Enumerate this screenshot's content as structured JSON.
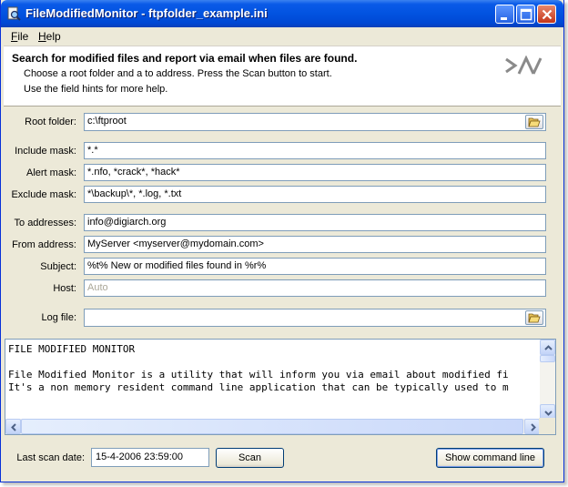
{
  "window": {
    "title": "FileModifiedMonitor - ftpfolder_example.ini",
    "icons": {
      "app": "magnifier-file-icon",
      "minimize": "minimize-icon",
      "maximize": "maximize-icon",
      "close": "close-icon"
    }
  },
  "menu": {
    "file": "File",
    "help": "Help"
  },
  "header": {
    "title": "Search for modified files and report via email when files are found.",
    "line1": "Choose a root folder and a to address. Press the Scan button to start.",
    "line2": "Use the field hints for more help.",
    "logo_icon": "digiarch-logo-icon"
  },
  "form": {
    "root_folder": {
      "label": "Root folder:",
      "value": "c:\\ftproot",
      "icon": "folder-open-icon"
    },
    "include_mask": {
      "label": "Include mask:",
      "value": "*.*"
    },
    "alert_mask": {
      "label": "Alert mask:",
      "value": "*.nfo, *crack*, *hack*"
    },
    "exclude_mask": {
      "label": "Exclude mask:",
      "value": "*\\backup\\*, *.log, *.txt"
    },
    "to_addresses": {
      "label": "To addresses:",
      "value": "info@digiarch.org"
    },
    "from_address": {
      "label": "From address:",
      "value": "MyServer <myserver@mydomain.com>"
    },
    "subject": {
      "label": "Subject:",
      "value": "%t% New or modified files found in %r%"
    },
    "host": {
      "label": "Host:",
      "value": "Auto"
    },
    "log_file": {
      "label": "Log file:",
      "value": "",
      "icon": "folder-open-icon"
    }
  },
  "memo": {
    "lines": [
      "FILE MODIFIED MONITOR",
      "",
      "File Modified Monitor is a utility that will inform you via email about modified fi",
      "It's a non memory resident command line application that can be typically used to m"
    ]
  },
  "footer": {
    "last_scan_label": "Last scan date:",
    "last_scan_value": "15-4-2006 23:59:00",
    "scan_button": "Scan",
    "show_cmd_button": "Show command line"
  }
}
